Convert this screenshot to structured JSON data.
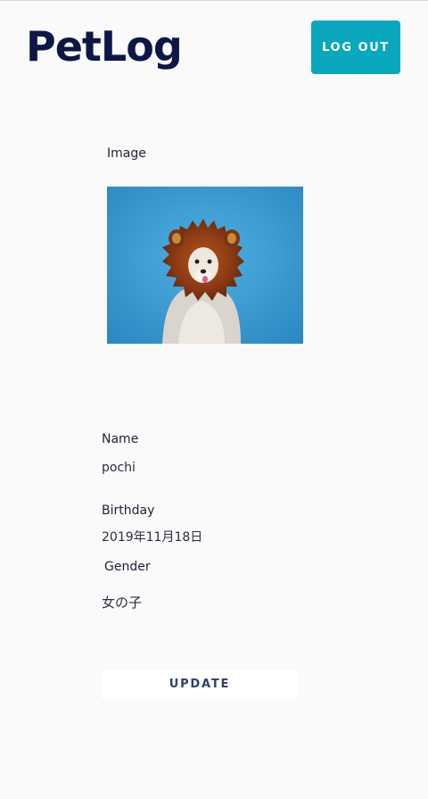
{
  "header": {
    "logo": "PetLog",
    "logout_label": "LOG OUT"
  },
  "image_section": {
    "label": "Image",
    "photo_icon": "pet-photo-dog-in-lion-mane"
  },
  "fields": {
    "name_label": "Name",
    "name_value": "pochi",
    "birthday_label": "Birthday",
    "birthday_value": "2019年11月18日",
    "gender_label": "Gender",
    "gender_value": "女の子"
  },
  "actions": {
    "update_label": "UPDATE"
  },
  "colors": {
    "logo": "#0e1646",
    "accent": "#0aa8bf",
    "photo_background": "#3d9fd4",
    "update_text": "#2f3f6b"
  }
}
